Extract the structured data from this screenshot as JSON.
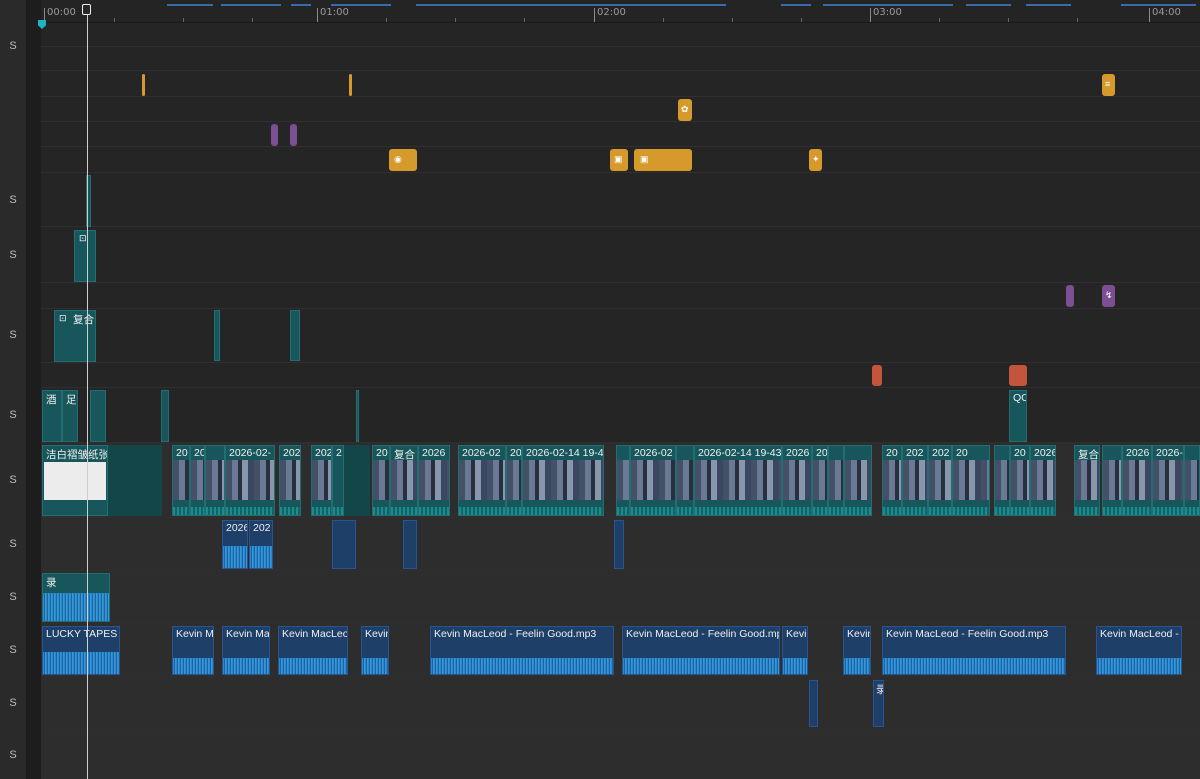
{
  "timeline": {
    "ruler_labels": [
      "00:00",
      "01:00",
      "02:00",
      "03:00",
      "04:00"
    ],
    "track_labels": [
      "S",
      "S",
      "S",
      "S",
      "S",
      "S",
      "S",
      "S",
      "S",
      "S",
      "S"
    ]
  },
  "clips": {
    "image_track": {
      "first": "洁白褶皱纸张",
      "c1": "20",
      "c2": "20",
      "c3": "2026-02-",
      "c4": "202",
      "c5": "2",
      "c6": "20",
      "c7": "复合",
      "c8": "2026",
      "c9": "2026-02",
      "c10": "20",
      "c11": "2026-02-14 19-4",
      "c12": "2026-02",
      "c13": "2026-02-14 19-43",
      "c14": "2026",
      "c15": "20",
      "c16": "202",
      "c17": "2026",
      "c18": "复合",
      "c19": "2026-",
      "c20": "QC"
    },
    "blue_track": [
      "2026",
      "202"
    ],
    "green_track": "录",
    "overlay_track_a": [
      "复合"
    ],
    "overlay_track_b": [
      "酒",
      "足"
    ],
    "audio_track": [
      "LUCKY TAPES - I",
      "Kevin M",
      "Kevin Ma",
      "Kevin MacLeod",
      "Kevin",
      "Kevin MacLeod - Feelin Good.mp3",
      "Kevin MacLeod - Feelin Good.mp3",
      "Kevin",
      "Kevin",
      "Kevin MacLeod - Feelin Good.mp3",
      "Kevin MacLeod - F"
    ],
    "record_track": "录"
  },
  "colors": {
    "teal": "#17565a",
    "blue": "#1e3f68",
    "orange": "#d69a2c",
    "purple": "#7c4e94",
    "red": "#c2553c",
    "playhead": "#cfcfcf"
  }
}
